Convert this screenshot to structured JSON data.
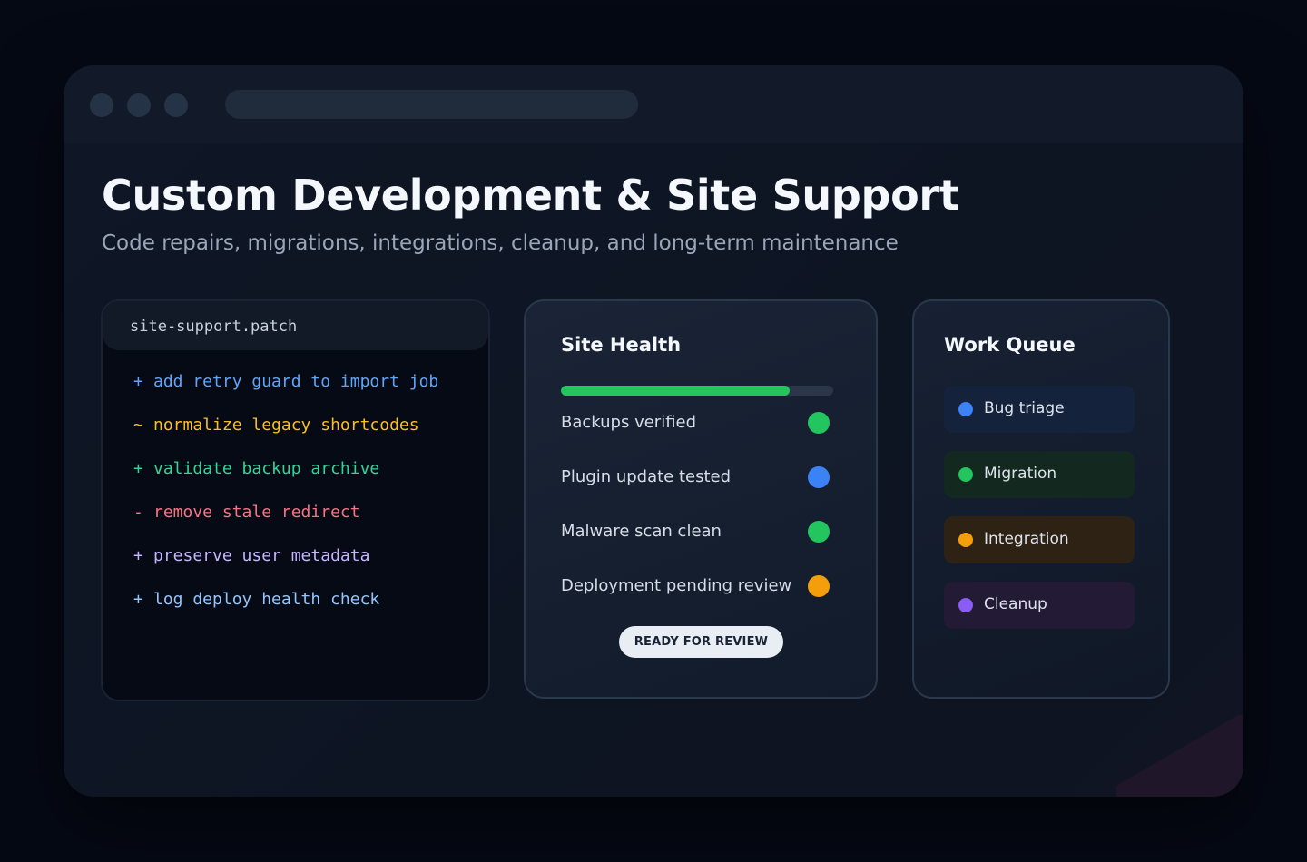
{
  "hero": {
    "title": "Custom Development & Site Support",
    "subtitle": "Code repairs, migrations, integrations, cleanup, and long-term maintenance"
  },
  "patch": {
    "filename": "site-support.patch",
    "lines": [
      {
        "symbol": "+",
        "text": "add retry guard to import job",
        "color": "#60a5fa"
      },
      {
        "symbol": "~",
        "text": "normalize legacy shortcodes",
        "color": "#fbbf24"
      },
      {
        "symbol": "+",
        "text": "validate backup archive",
        "color": "#34d399"
      },
      {
        "symbol": "-",
        "text": "remove stale redirect",
        "color": "#fb7185"
      },
      {
        "symbol": "+",
        "text": "preserve user metadata",
        "color": "#c4b5fd"
      },
      {
        "symbol": "+",
        "text": "log deploy health check",
        "color": "#93c5fd"
      }
    ]
  },
  "health": {
    "title": "Site Health",
    "progress_percent": 84,
    "progress_color": "#22c55e",
    "checks": [
      {
        "label": "Backups verified",
        "status_color": "#22c55e"
      },
      {
        "label": "Plugin update tested",
        "status_color": "#3b82f6"
      },
      {
        "label": "Malware scan clean",
        "status_color": "#22c55e"
      },
      {
        "label": "Deployment pending review",
        "status_color": "#f59e0b"
      }
    ],
    "button_label": "READY FOR REVIEW"
  },
  "queue": {
    "title": "Work Queue",
    "items": [
      {
        "label": "Bug triage",
        "dot_color": "#3b82f6",
        "bg_color": "#14233b"
      },
      {
        "label": "Migration",
        "dot_color": "#22c55e",
        "bg_color": "#13291f"
      },
      {
        "label": "Integration",
        "dot_color": "#f59e0b",
        "bg_color": "#2d2214"
      },
      {
        "label": "Cleanup",
        "dot_color": "#8b5cf6",
        "bg_color": "#231a35"
      }
    ]
  }
}
